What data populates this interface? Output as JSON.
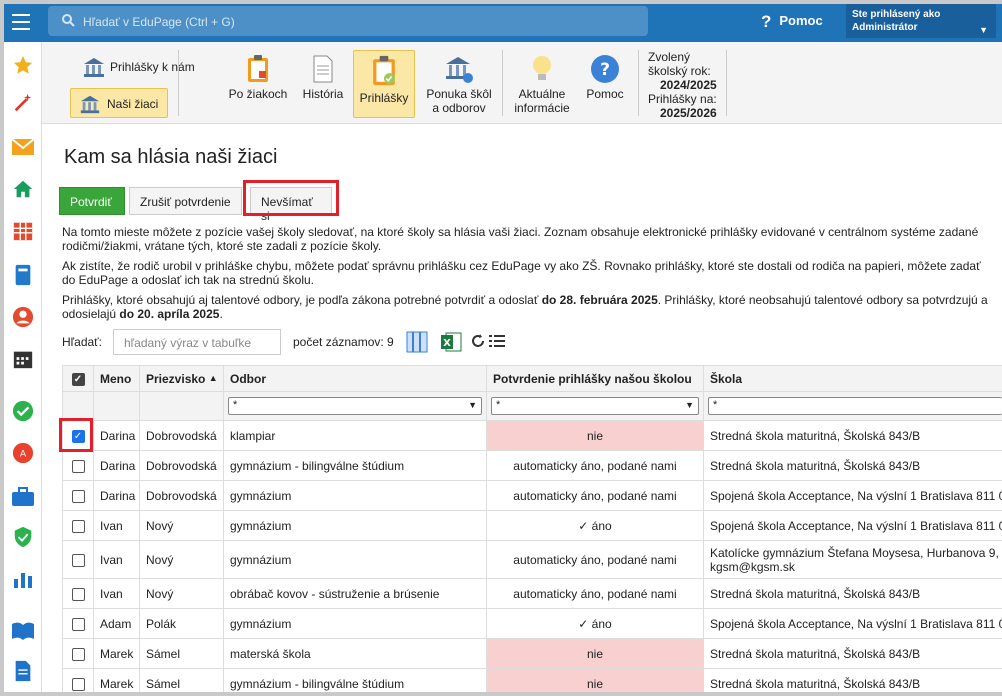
{
  "topbar": {
    "search_placeholder": "Hľadať v EduPage (Ctrl + G)",
    "help_label": "Pomoc",
    "user_line1": "Ste prihlásený ako",
    "user_line2": "Administrátor"
  },
  "toolbar": {
    "prihlasky_k_nam": "Prihlášky k nám",
    "nasi_ziaci": "Naši žiaci",
    "po_ziakoch": "Po žiakoch",
    "historia": "História",
    "prihlasky": "Prihlášky",
    "ponuka_1": "Ponuka škôl",
    "ponuka_2": "a odborov",
    "aktualne_1": "Aktuálne",
    "aktualne_2": "informácie",
    "pomoc": "Pomoc",
    "year_label_1": "Zvolený",
    "year_label_2": "školský rok:",
    "year_value": "2024/2025",
    "app_label": "Prihlášky na:",
    "app_value": "2025/2026"
  },
  "page": {
    "title": "Kam sa hlásia naši žiaci",
    "btn_confirm": "Potvrdiť",
    "btn_cancel_confirm": "Zrušiť potvrdenie",
    "btn_ignore": "Nevšímať si",
    "p1_l1": "Na tomto mieste môžete z pozície vašej školy sledovať, na ktoré školy sa hlásia vaši žiaci. Zoznam obsahuje elektronické prihlášky evidované v centrálnom systéme zadané",
    "p1_l2": "rodičmi/žiakmi, vrátane tých, ktoré ste zadali z pozície školy.",
    "p2_l1": "Ak zistíte, že rodič urobil v prihláške chybu, môžete podať správnu prihlášku cez EduPage vy ako ZŠ. Rovnako prihlášky, ktoré ste dostali od rodiča na papieri, môžete zadať",
    "p2_l2": "do EduPage a odoslať ich tak na strednú školu.",
    "p3_l1a": "Prihlášky, ktoré obsahujú aj talentové odbory, je podľa zákona potrebné potvrdiť a odoslať ",
    "p3_l1b": "do 28. februára 2025",
    "p3_l1c": ". Prihlášky, ktoré neobsahujú talentové odbory sa potvrdzujú a",
    "p3_l2a": "odosielajú ",
    "p3_l2b": "do 20. apríla 2025",
    "p3_l2c": ".",
    "search_label": "Hľadať:",
    "search_placeholder": "hľadaný výraz v tabuľke",
    "count_label": "počet záznamov: 9"
  },
  "table": {
    "headers": {
      "meno": "Meno",
      "priezvisko": "Priezvisko",
      "sort": "▲",
      "odbor": "Odbor",
      "potvrdenie": "Potvrdenie prihlášky našou školou",
      "skola": "Škola"
    },
    "filter_value": "*",
    "rows": [
      {
        "meno": "Darina",
        "priezvisko": "Dobrovodská",
        "odbor": "klampiar",
        "potvrdenie": "nie",
        "skola": "Stredná škola maturitná, Školská 843/B"
      },
      {
        "meno": "Darina",
        "priezvisko": "Dobrovodská",
        "odbor": "gymnázium - bilingválne štúdium",
        "potvrdenie": "automaticky áno, podané nami",
        "skola": "Stredná škola maturitná, Školská 843/B"
      },
      {
        "meno": "Darina",
        "priezvisko": "Dobrovodská",
        "odbor": "gymnázium",
        "potvrdenie": "automaticky áno, podané nami",
        "skola": "Spojená škola Acceptance, Na výslní 1 Bratislava 811 0"
      },
      {
        "meno": "Ivan",
        "priezvisko": "Nový",
        "odbor": "gymnázium",
        "potvrdenie": "✓ áno",
        "skola": "Spojená škola Acceptance, Na výslní 1 Bratislava 811 0"
      },
      {
        "meno": "Ivan",
        "priezvisko": "Nový",
        "odbor": "gymnázium",
        "potvrdenie": "automaticky áno, podané nami",
        "skola": "Katolícke gymnázium Štefana Moysesa, Hurbanova 9,",
        "skola2": "kgsm@kgsm.sk"
      },
      {
        "meno": "Ivan",
        "priezvisko": "Nový",
        "odbor": "obrábač kovov - sústruženie a brúsenie",
        "potvrdenie": "automaticky áno, podané nami",
        "skola": "Stredná škola maturitná, Školská 843/B"
      },
      {
        "meno": "Adam",
        "priezvisko": "Polák",
        "odbor": "gymnázium",
        "potvrdenie": "✓ áno",
        "skola": "Spojená škola Acceptance, Na výslní 1 Bratislava 811 0"
      },
      {
        "meno": "Marek",
        "priezvisko": "Sámel",
        "odbor": "materská škola",
        "potvrdenie": "nie",
        "skola": "Stredná škola maturitná, Školská 843/B"
      },
      {
        "meno": "Marek",
        "priezvisko": "Sámel",
        "odbor": "gymnázium - bilingválne štúdium",
        "potvrdenie": "nie",
        "skola": "Stredná škola maturitná, Školská 843/B"
      }
    ]
  },
  "colors": {
    "topbar": "#1f73b7",
    "accent": "#3aa53a",
    "highlight": "#e0202a",
    "pink": "#f9d0d0"
  }
}
